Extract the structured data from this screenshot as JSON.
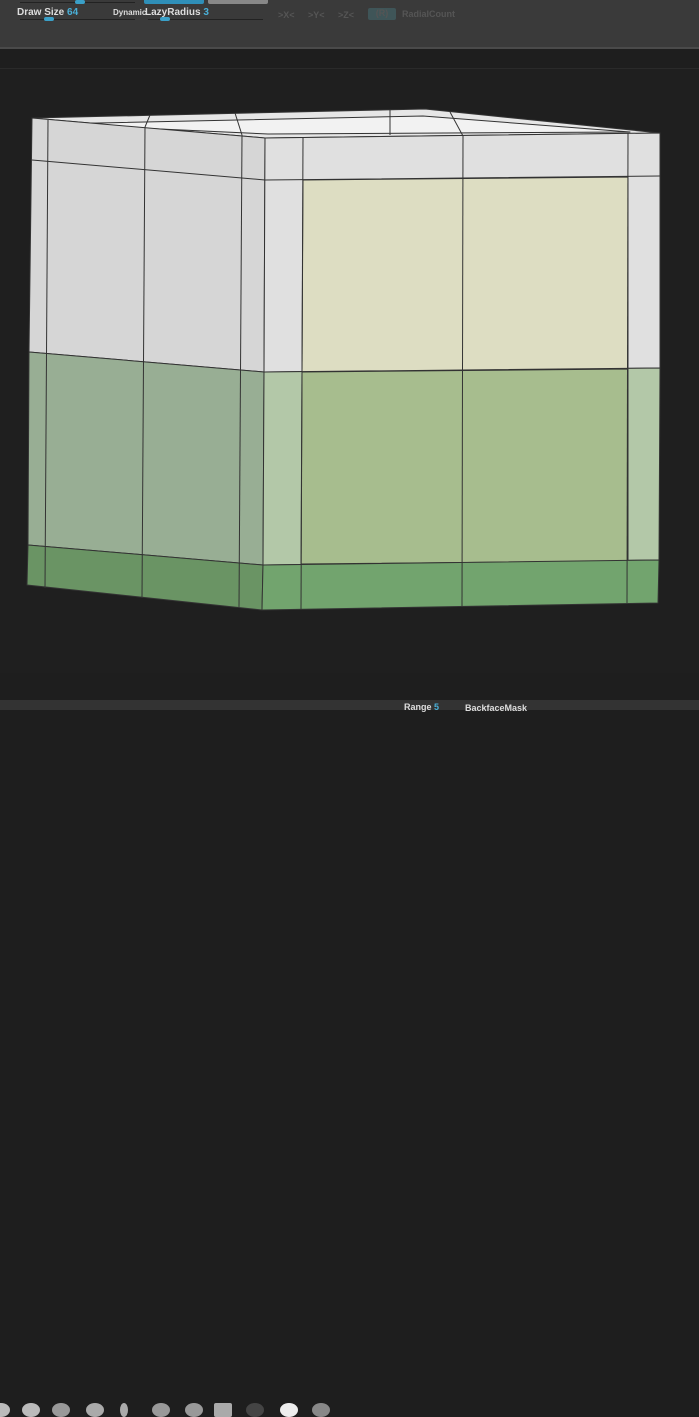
{
  "toolbar": {
    "draw_size_label": "Draw Size",
    "draw_size_value": "64",
    "dynamic_label": "Dynamic",
    "lazy_radius_label": "LazyRadius",
    "lazy_radius_value": "3",
    "sym_x": ">X<",
    "sym_y": ">Y<",
    "sym_z": ">Z<",
    "sym_r": "(R)",
    "radial_count": "RadialCount"
  },
  "bottombar": {
    "range_label": "Range",
    "range_value": "5",
    "backface_mask": "BackfaceMask"
  },
  "colors": {
    "accent": "#3aa0c8",
    "polygroup_white": "#dcdcdc",
    "polygroup_yellow": "#ddddc2",
    "polygroup_green": "#a7bd90",
    "polygroup_darkgreen": "#6c9f68"
  }
}
